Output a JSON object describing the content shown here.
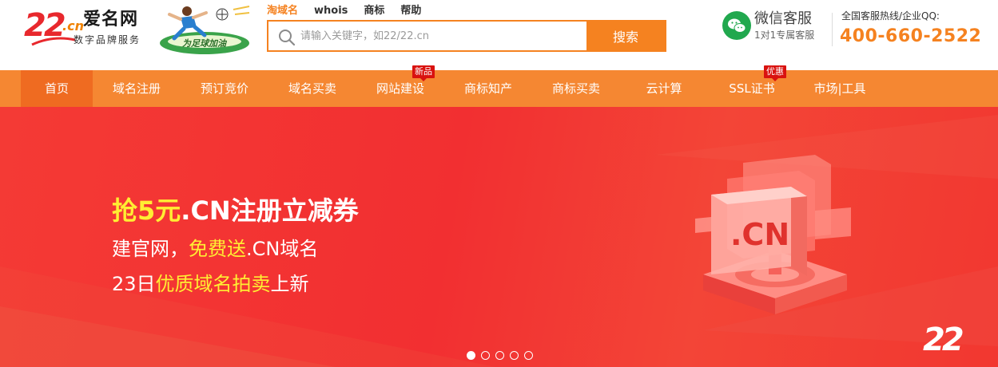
{
  "brand": {
    "logo_num": "22",
    "logo_cn": ".cn",
    "name": "爱名网",
    "slogan": "数字品牌服务",
    "promo_text": "为足球加油"
  },
  "topnav": {
    "items": [
      {
        "label": "淘域名",
        "active": true
      },
      {
        "label": "whois",
        "active": false
      },
      {
        "label": "商标",
        "active": false
      },
      {
        "label": "帮助",
        "active": false
      }
    ]
  },
  "search": {
    "placeholder": "请输入关键字，如22/22.cn",
    "button_label": "搜索"
  },
  "wechat": {
    "title": "微信客服",
    "subtitle": "1对1专属客服"
  },
  "hotline": {
    "label": "全国客服热线/企业QQ:",
    "number": "400-660-2522"
  },
  "mainnav": {
    "items": [
      {
        "label": "首页",
        "active": true,
        "badge": ""
      },
      {
        "label": "域名注册",
        "active": false,
        "badge": ""
      },
      {
        "label": "预订竞价",
        "active": false,
        "badge": ""
      },
      {
        "label": "域名买卖",
        "active": false,
        "badge": ""
      },
      {
        "label": "网站建设",
        "active": false,
        "badge": "新品"
      },
      {
        "label": "商标知产",
        "active": false,
        "badge": ""
      },
      {
        "label": "商标买卖",
        "active": false,
        "badge": ""
      },
      {
        "label": "云计算",
        "active": false,
        "badge": ""
      },
      {
        "label": "SSL证书",
        "active": false,
        "badge": "优惠"
      },
      {
        "label": "市场|工具",
        "active": false,
        "badge": ""
      }
    ]
  },
  "banner": {
    "line1_highlight": "抢5元",
    "line1_rest": ".CN注册立减券",
    "line2_a": "建官网，",
    "line2_highlight": "免费送",
    "line2_b": ".CN域名",
    "line3_a": "23日",
    "line3_highlight": "优质域名拍卖",
    "line3_b": "上新",
    "art_label": ".CN",
    "corner_logo": "22",
    "slides_count": 5,
    "active_slide": 1
  },
  "colors": {
    "accent": "#f58220",
    "nav_bg": "#f58732",
    "nav_active": "#ef6b21",
    "banner_red": "#f23730",
    "highlight_yellow": "#ffee33",
    "wechat_green": "#21a84e"
  }
}
